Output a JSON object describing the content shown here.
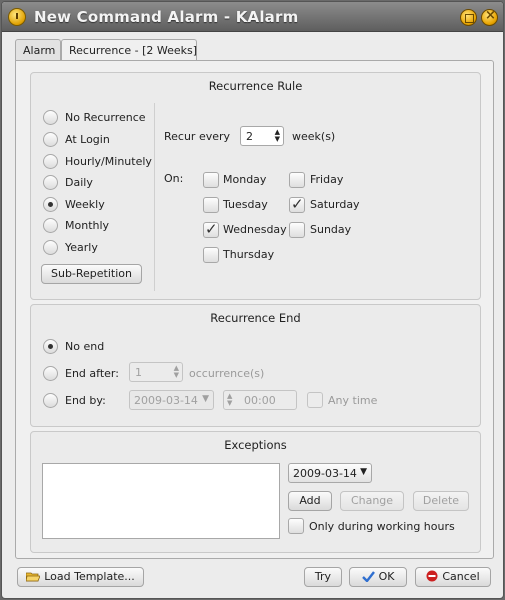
{
  "window": {
    "title": "New Command Alarm - KAlarm"
  },
  "tabs": [
    {
      "label": "Alarm"
    },
    {
      "label": "Recurrence - [2 Weeks]"
    }
  ],
  "recurrence_rule": {
    "title": "Recurrence Rule",
    "options": [
      {
        "label": "No Recurrence",
        "checked": false
      },
      {
        "label": "At Login",
        "checked": false
      },
      {
        "label": "Hourly/Minutely",
        "checked": false
      },
      {
        "label": "Daily",
        "checked": false
      },
      {
        "label": "Weekly",
        "checked": true
      },
      {
        "label": "Monthly",
        "checked": false
      },
      {
        "label": "Yearly",
        "checked": false
      }
    ],
    "sub_repetition": "Sub-Repetition",
    "recur_every_label": "Recur every",
    "recur_every_value": "2",
    "recur_unit": "week(s)",
    "on_label": "On:",
    "days": [
      {
        "label": "Monday",
        "checked": false
      },
      {
        "label": "Tuesday",
        "checked": false
      },
      {
        "label": "Wednesday",
        "checked": true
      },
      {
        "label": "Thursday",
        "checked": false
      },
      {
        "label": "Friday",
        "checked": false
      },
      {
        "label": "Saturday",
        "checked": true
      },
      {
        "label": "Sunday",
        "checked": false
      }
    ]
  },
  "recurrence_end": {
    "title": "Recurrence End",
    "no_end": "No end",
    "end_after": "End after:",
    "end_after_value": "1",
    "occurrences": "occurrence(s)",
    "end_by": "End by:",
    "end_date": "2009-03-14",
    "end_time": "00:00",
    "any_time": "Any time"
  },
  "exceptions": {
    "title": "Exceptions",
    "date": "2009-03-14",
    "add": "Add",
    "change": "Change",
    "delete": "Delete",
    "working_hours": "Only during working hours"
  },
  "footer": {
    "load_template": "Load Template...",
    "try": "Try",
    "ok": "OK",
    "cancel": "Cancel"
  },
  "colors": {
    "titlebar": "#6e6e6e",
    "accent": "#e8a400",
    "ok_icon": "#2f6fd0",
    "cancel_icon": "#cc2020"
  },
  "icons": [
    "app-alarm-icon",
    "maximize-icon",
    "close-icon",
    "folder-open-icon",
    "check-icon",
    "cancel-icon"
  ]
}
